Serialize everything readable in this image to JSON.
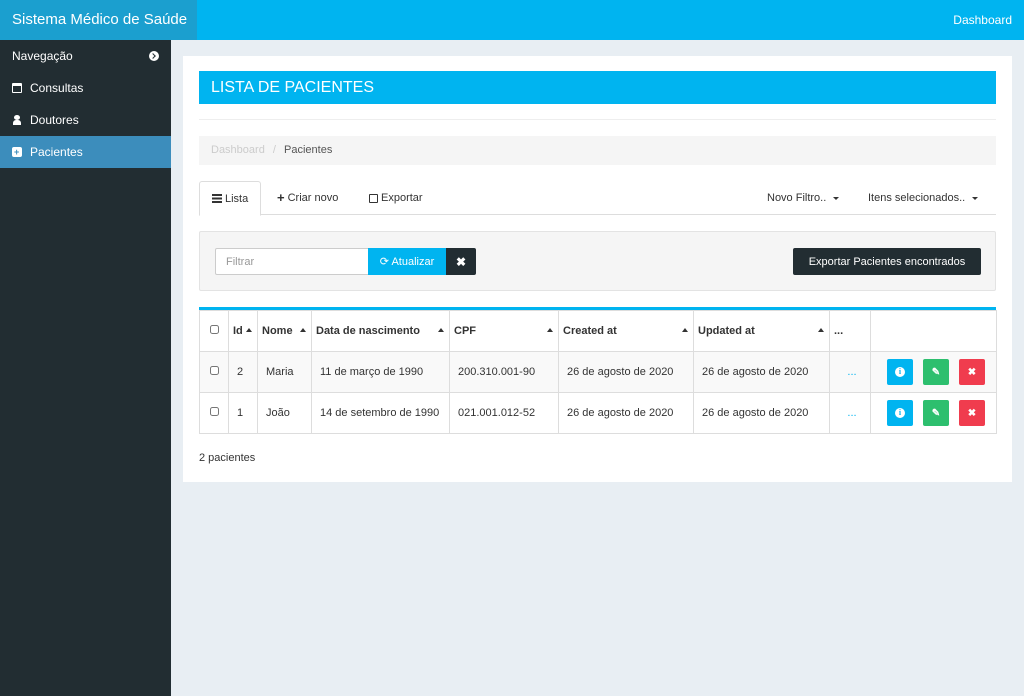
{
  "app": {
    "title": "Sistema Médico de Saúde",
    "top_link": "Dashboard"
  },
  "sidebar": {
    "header": "Navegação",
    "items": [
      {
        "label": "Consultas",
        "icon": "calendar-icon"
      },
      {
        "label": "Doutores",
        "icon": "user-md-icon"
      },
      {
        "label": "Pacientes",
        "icon": "medkit-icon",
        "active": true
      }
    ]
  },
  "page": {
    "title": "LISTA DE PACIENTES"
  },
  "breadcrumb": {
    "root": "Dashboard",
    "separator": "/",
    "current": "Pacientes"
  },
  "tabs": {
    "list": "Lista",
    "create": "Criar novo",
    "export": "Exportar",
    "new_filter": "Novo Filtro..",
    "selected_items": "Itens selecionados.."
  },
  "filter": {
    "placeholder": "Filtrar",
    "refresh_label": "Atualizar",
    "clear_label": "✖",
    "export_label": "Exportar Pacientes encontrados"
  },
  "table": {
    "columns": [
      "Id",
      "Nome",
      "Data de nascimento",
      "CPF",
      "Created at",
      "Updated at",
      "..."
    ],
    "rows": [
      {
        "id": "2",
        "nome": "Maria",
        "nascimento": "11 de março de 1990",
        "cpf": "200.310.001-90",
        "created": "26 de agosto de 2020",
        "updated": "26 de agosto de 2020",
        "extra": "..."
      },
      {
        "id": "1",
        "nome": "João",
        "nascimento": "14 de setembro de 1990",
        "cpf": "021.001.012-52",
        "created": "26 de agosto de 2020",
        "updated": "26 de agosto de 2020",
        "extra": "..."
      }
    ]
  },
  "footer": {
    "count": "2 pacientes"
  },
  "colors": {
    "accent": "#00b4f0",
    "sidebar": "#222d32",
    "active": "#3c8dbc",
    "success": "#2dbf6e",
    "danger": "#f03c4e"
  }
}
